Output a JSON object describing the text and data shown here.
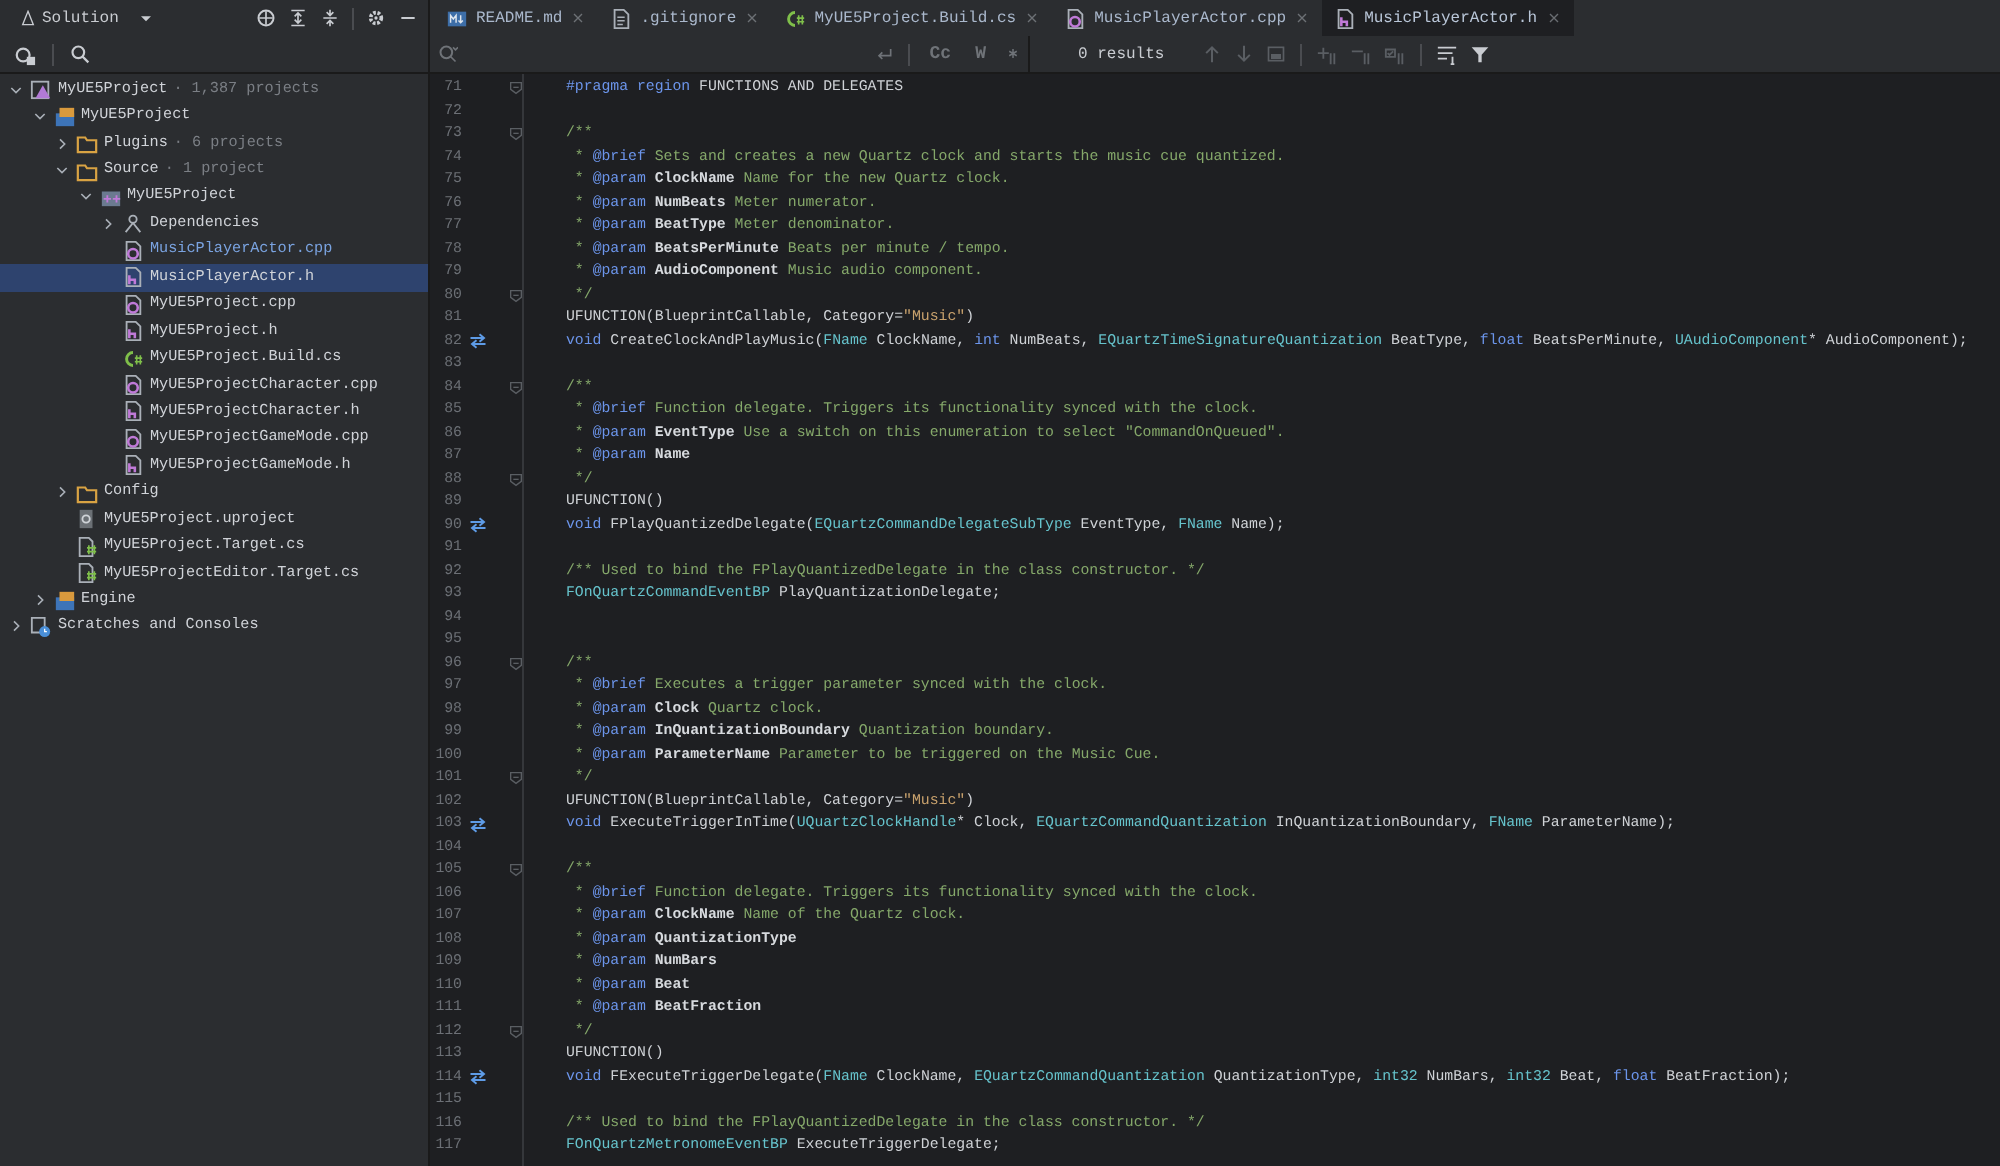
{
  "solution_view": {
    "label": "Solution"
  },
  "tabs": [
    {
      "label": "README.md",
      "kind": "markdown",
      "selected": false
    },
    {
      "label": ".gitignore",
      "kind": "gitignore",
      "selected": false
    },
    {
      "label": "MyUE5Project.Build.cs",
      "kind": "cs",
      "selected": false
    },
    {
      "label": "MusicPlayerActor.cpp",
      "kind": "cpp",
      "selected": false
    },
    {
      "label": "MusicPlayerActor.h",
      "kind": "h",
      "selected": true
    }
  ],
  "search": {
    "options": [
      "Cc",
      "W"
    ],
    "results": "0 results"
  },
  "tree": [
    {
      "label": "MyUE5Project",
      "note": "· 1,387 projects",
      "kind": "solution",
      "expanded": true,
      "selected": false,
      "modified": false,
      "children": [
        {
          "label": "MyUE5Project",
          "kind": "module",
          "expanded": true,
          "selected": false,
          "modified": false,
          "children": [
            {
              "label": "Plugins",
              "note": "· 6 projects",
              "kind": "folder",
              "expanded": false,
              "selected": false,
              "modified": false
            },
            {
              "label": "Source",
              "note": "· 1 project",
              "kind": "folder",
              "expanded": true,
              "selected": false,
              "modified": false,
              "children": [
                {
                  "label": "MyUE5Project",
                  "kind": "cppmodule",
                  "expanded": true,
                  "selected": false,
                  "modified": false,
                  "children": [
                    {
                      "label": "Dependencies",
                      "kind": "deps",
                      "expanded": false,
                      "selected": false,
                      "modified": false
                    },
                    {
                      "label": "MusicPlayerActor.cpp",
                      "kind": "cpp",
                      "selected": false,
                      "modified": true
                    },
                    {
                      "label": "MusicPlayerActor.h",
                      "kind": "h",
                      "selected": true,
                      "modified": false
                    },
                    {
                      "label": "MyUE5Project.cpp",
                      "kind": "cpp",
                      "selected": false,
                      "modified": false
                    },
                    {
                      "label": "MyUE5Project.h",
                      "kind": "h",
                      "selected": false,
                      "modified": false
                    },
                    {
                      "label": "MyUE5Project.Build.cs",
                      "kind": "cs",
                      "selected": false,
                      "modified": false
                    },
                    {
                      "label": "MyUE5ProjectCharacter.cpp",
                      "kind": "cpp",
                      "selected": false,
                      "modified": false
                    },
                    {
                      "label": "MyUE5ProjectCharacter.h",
                      "kind": "h",
                      "selected": false,
                      "modified": false
                    },
                    {
                      "label": "MyUE5ProjectGameMode.cpp",
                      "kind": "cpp",
                      "selected": false,
                      "modified": false
                    },
                    {
                      "label": "MyUE5ProjectGameMode.h",
                      "kind": "h",
                      "selected": false,
                      "modified": false
                    }
                  ]
                }
              ]
            },
            {
              "label": "Config",
              "kind": "folder",
              "expanded": false,
              "selected": false,
              "modified": false
            },
            {
              "label": "MyUE5Project.uproject",
              "kind": "uproject",
              "selected": false,
              "modified": false
            },
            {
              "label": "MyUE5Project.Target.cs",
              "kind": "target",
              "selected": false,
              "modified": false
            },
            {
              "label": "MyUE5ProjectEditor.Target.cs",
              "kind": "target",
              "selected": false,
              "modified": false
            }
          ]
        },
        {
          "label": "Engine",
          "kind": "module",
          "expanded": false,
          "selected": false,
          "modified": false
        }
      ]
    },
    {
      "label": "Scratches and Consoles",
      "kind": "scratches",
      "expanded": false,
      "selected": false,
      "modified": false
    }
  ],
  "editor": {
    "lines": [
      {
        "number": "71",
        "kind": "fold",
        "segments": [
          {
            "kind": "pp",
            "text": "#pragma region"
          },
          {
            "kind": "p",
            "text": " FUNCTIONS AND DELEGATES"
          }
        ]
      },
      {
        "number": "72"
      },
      {
        "number": "73",
        "kind": "fold",
        "segments": [
          {
            "kind": "c",
            "text": "/**"
          }
        ]
      },
      {
        "number": "74",
        "segments": [
          {
            "kind": "c",
            "text": " * "
          },
          {
            "kind": "d",
            "text": "@brief"
          },
          {
            "kind": "c",
            "text": " Sets and creates a new Quartz clock and starts the music cue quantized."
          }
        ]
      },
      {
        "number": "75",
        "segments": [
          {
            "kind": "c",
            "text": " * "
          },
          {
            "kind": "d",
            "text": "@param"
          },
          {
            "kind": "n",
            "text": " ClockName"
          },
          {
            "kind": "c",
            "text": " Name for the new Quartz clock."
          }
        ]
      },
      {
        "number": "76",
        "segments": [
          {
            "kind": "c",
            "text": " * "
          },
          {
            "kind": "d",
            "text": "@param"
          },
          {
            "kind": "n",
            "text": " NumBeats"
          },
          {
            "kind": "c",
            "text": " Meter numerator."
          }
        ]
      },
      {
        "number": "77",
        "segments": [
          {
            "kind": "c",
            "text": " * "
          },
          {
            "kind": "d",
            "text": "@param"
          },
          {
            "kind": "n",
            "text": " BeatType"
          },
          {
            "kind": "c",
            "text": " Meter denominator."
          }
        ]
      },
      {
        "number": "78",
        "segments": [
          {
            "kind": "c",
            "text": " * "
          },
          {
            "kind": "d",
            "text": "@param"
          },
          {
            "kind": "n",
            "text": " BeatsPerMinute"
          },
          {
            "kind": "c",
            "text": " Beats per minute / tempo."
          }
        ]
      },
      {
        "number": "79",
        "segments": [
          {
            "kind": "c",
            "text": " * "
          },
          {
            "kind": "d",
            "text": "@param"
          },
          {
            "kind": "n",
            "text": " AudioComponent"
          },
          {
            "kind": "c",
            "text": " Music audio component."
          }
        ]
      },
      {
        "number": "80",
        "kind": "fold",
        "segments": [
          {
            "kind": "c",
            "text": " */"
          }
        ]
      },
      {
        "number": "81",
        "segments": [
          {
            "kind": "p",
            "text": "UFUNCTION(BlueprintCallable, Category="
          },
          {
            "kind": "s",
            "text": "\"Music\""
          },
          {
            "kind": "p",
            "text": ")"
          }
        ]
      },
      {
        "number": "82",
        "kind": "impl",
        "segments": [
          {
            "kind": "k",
            "text": "void"
          },
          {
            "kind": "p",
            "text": " CreateClockAndPlayMusic("
          },
          {
            "kind": "t",
            "text": "FName"
          },
          {
            "kind": "p",
            "text": " ClockName, "
          },
          {
            "kind": "k",
            "text": "int"
          },
          {
            "kind": "p",
            "text": " NumBeats, "
          },
          {
            "kind": "t",
            "text": "EQuartzTimeSignatureQuantization"
          },
          {
            "kind": "p",
            "text": " BeatType, "
          },
          {
            "kind": "k",
            "text": "float"
          },
          {
            "kind": "p",
            "text": " BeatsPerMinute, "
          },
          {
            "kind": "t",
            "text": "UAudioComponent"
          },
          {
            "kind": "p",
            "text": "* AudioComponent);"
          }
        ]
      },
      {
        "number": "83"
      },
      {
        "number": "84",
        "kind": "fold",
        "segments": [
          {
            "kind": "c",
            "text": "/**"
          }
        ]
      },
      {
        "number": "85",
        "segments": [
          {
            "kind": "c",
            "text": " * "
          },
          {
            "kind": "d",
            "text": "@brief"
          },
          {
            "kind": "c",
            "text": " Function delegate. Triggers its functionality synced with the clock."
          }
        ]
      },
      {
        "number": "86",
        "segments": [
          {
            "kind": "c",
            "text": " * "
          },
          {
            "kind": "d",
            "text": "@param"
          },
          {
            "kind": "n",
            "text": " EventType"
          },
          {
            "kind": "c",
            "text": " Use a switch on this enumeration to select \"CommandOnQueued\"."
          }
        ]
      },
      {
        "number": "87",
        "segments": [
          {
            "kind": "c",
            "text": " * "
          },
          {
            "kind": "d",
            "text": "@param"
          },
          {
            "kind": "n",
            "text": " Name"
          }
        ]
      },
      {
        "number": "88",
        "kind": "fold",
        "segments": [
          {
            "kind": "c",
            "text": " */"
          }
        ]
      },
      {
        "number": "89",
        "segments": [
          {
            "kind": "p",
            "text": "UFUNCTION()"
          }
        ]
      },
      {
        "number": "90",
        "kind": "impl",
        "segments": [
          {
            "kind": "k",
            "text": "void"
          },
          {
            "kind": "p",
            "text": " FPlayQuantizedDelegate("
          },
          {
            "kind": "t",
            "text": "EQuartzCommandDelegateSubType"
          },
          {
            "kind": "p",
            "text": " EventType, "
          },
          {
            "kind": "t",
            "text": "FName"
          },
          {
            "kind": "p",
            "text": " Name);"
          }
        ]
      },
      {
        "number": "91"
      },
      {
        "number": "92",
        "segments": [
          {
            "kind": "c",
            "text": "/** Used to bind the FPlayQuantizedDelegate in the class constructor. */"
          }
        ]
      },
      {
        "number": "93",
        "segments": [
          {
            "kind": "t",
            "text": "FOnQuartzCommandEventBP"
          },
          {
            "kind": "p",
            "text": " PlayQuantizationDelegate;"
          }
        ]
      },
      {
        "number": "94"
      },
      {
        "number": "95"
      },
      {
        "number": "96",
        "kind": "fold",
        "segments": [
          {
            "kind": "c",
            "text": "/**"
          }
        ]
      },
      {
        "number": "97",
        "segments": [
          {
            "kind": "c",
            "text": " * "
          },
          {
            "kind": "d",
            "text": "@brief"
          },
          {
            "kind": "c",
            "text": " Executes a trigger parameter synced with the clock."
          }
        ]
      },
      {
        "number": "98",
        "segments": [
          {
            "kind": "c",
            "text": " * "
          },
          {
            "kind": "d",
            "text": "@param"
          },
          {
            "kind": "n",
            "text": " Clock"
          },
          {
            "kind": "c",
            "text": " Quartz clock."
          }
        ]
      },
      {
        "number": "99",
        "segments": [
          {
            "kind": "c",
            "text": " * "
          },
          {
            "kind": "d",
            "text": "@param"
          },
          {
            "kind": "n",
            "text": " InQuantizationBoundary"
          },
          {
            "kind": "c",
            "text": " Quantization boundary."
          }
        ]
      },
      {
        "number": "100",
        "segments": [
          {
            "kind": "c",
            "text": " * "
          },
          {
            "kind": "d",
            "text": "@param"
          },
          {
            "kind": "n",
            "text": " ParameterName"
          },
          {
            "kind": "c",
            "text": " Parameter to be triggered on the Music Cue."
          }
        ]
      },
      {
        "number": "101",
        "kind": "fold",
        "segments": [
          {
            "kind": "c",
            "text": " */"
          }
        ]
      },
      {
        "number": "102",
        "segments": [
          {
            "kind": "p",
            "text": "UFUNCTION(BlueprintCallable, Category="
          },
          {
            "kind": "s",
            "text": "\"Music\""
          },
          {
            "kind": "p",
            "text": ")"
          }
        ]
      },
      {
        "number": "103",
        "kind": "impl",
        "segments": [
          {
            "kind": "k",
            "text": "void"
          },
          {
            "kind": "p",
            "text": " ExecuteTriggerInTime("
          },
          {
            "kind": "t",
            "text": "UQuartzClockHandle"
          },
          {
            "kind": "p",
            "text": "* Clock, "
          },
          {
            "kind": "t",
            "text": "EQuartzCommandQuantization"
          },
          {
            "kind": "p",
            "text": " InQuantizationBoundary, "
          },
          {
            "kind": "t",
            "text": "FName"
          },
          {
            "kind": "p",
            "text": " ParameterName);"
          }
        ]
      },
      {
        "number": "104"
      },
      {
        "number": "105",
        "kind": "fold",
        "segments": [
          {
            "kind": "c",
            "text": "/**"
          }
        ]
      },
      {
        "number": "106",
        "segments": [
          {
            "kind": "c",
            "text": " * "
          },
          {
            "kind": "d",
            "text": "@brief"
          },
          {
            "kind": "c",
            "text": " Function delegate. Triggers its functionality synced with the clock."
          }
        ]
      },
      {
        "number": "107",
        "segments": [
          {
            "kind": "c",
            "text": " * "
          },
          {
            "kind": "d",
            "text": "@param"
          },
          {
            "kind": "n",
            "text": " ClockName"
          },
          {
            "kind": "c",
            "text": " Name of the Quartz clock."
          }
        ]
      },
      {
        "number": "108",
        "segments": [
          {
            "kind": "c",
            "text": " * "
          },
          {
            "kind": "d",
            "text": "@param"
          },
          {
            "kind": "n",
            "text": " QuantizationType"
          }
        ]
      },
      {
        "number": "109",
        "segments": [
          {
            "kind": "c",
            "text": " * "
          },
          {
            "kind": "d",
            "text": "@param"
          },
          {
            "kind": "n",
            "text": " NumBars"
          }
        ]
      },
      {
        "number": "110",
        "segments": [
          {
            "kind": "c",
            "text": " * "
          },
          {
            "kind": "d",
            "text": "@param"
          },
          {
            "kind": "n",
            "text": " Beat"
          }
        ]
      },
      {
        "number": "111",
        "segments": [
          {
            "kind": "c",
            "text": " * "
          },
          {
            "kind": "d",
            "text": "@param"
          },
          {
            "kind": "n",
            "text": " BeatFraction"
          }
        ]
      },
      {
        "number": "112",
        "kind": "fold",
        "segments": [
          {
            "kind": "c",
            "text": " */"
          }
        ]
      },
      {
        "number": "113",
        "segments": [
          {
            "kind": "p",
            "text": "UFUNCTION()"
          }
        ]
      },
      {
        "number": "114",
        "kind": "impl",
        "segments": [
          {
            "kind": "k",
            "text": "void"
          },
          {
            "kind": "p",
            "text": " FExecuteTriggerDelegate("
          },
          {
            "kind": "t",
            "text": "FName"
          },
          {
            "kind": "p",
            "text": " ClockName, "
          },
          {
            "kind": "t",
            "text": "EQuartzCommandQuantization"
          },
          {
            "kind": "p",
            "text": " QuantizationType, "
          },
          {
            "kind": "t",
            "text": "int32"
          },
          {
            "kind": "p",
            "text": " NumBars, "
          },
          {
            "kind": "t",
            "text": "int32"
          },
          {
            "kind": "p",
            "text": " Beat, "
          },
          {
            "kind": "k",
            "text": "float"
          },
          {
            "kind": "p",
            "text": " BeatFraction);"
          }
        ]
      },
      {
        "number": "115"
      },
      {
        "number": "116",
        "segments": [
          {
            "kind": "c",
            "text": "/** Used to bind the FPlayQuantizedDelegate in the class constructor. */"
          }
        ]
      },
      {
        "number": "117",
        "segments": [
          {
            "kind": "t",
            "text": "FOnQuartzMetronomeEventBP"
          },
          {
            "kind": "p",
            "text": " ExecuteTriggerDelegate;"
          }
        ]
      }
    ]
  }
}
